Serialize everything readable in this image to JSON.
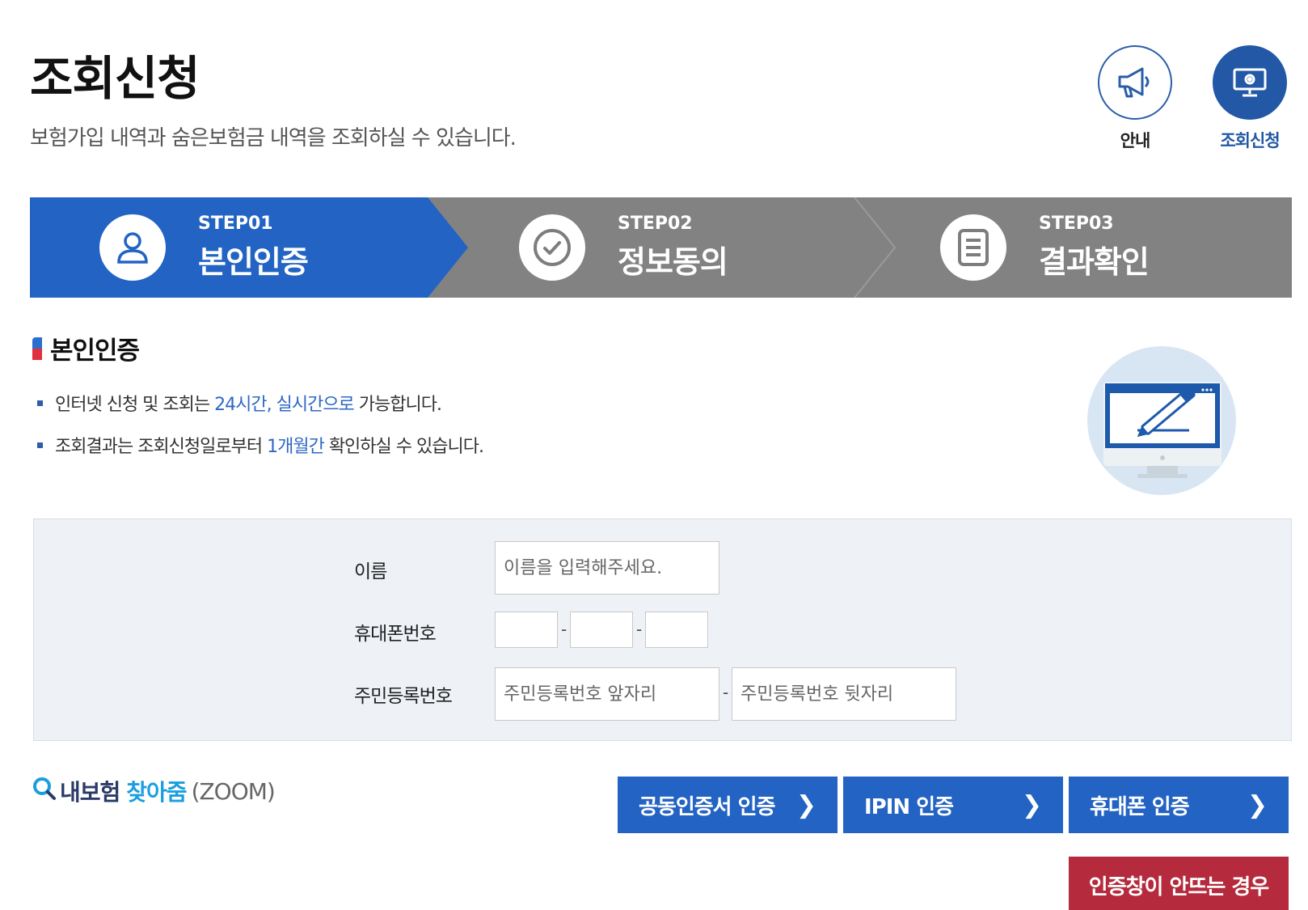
{
  "header": {
    "title": "조회신청",
    "subtitle": "보험가입 내역과 숨은보험금 내역을 조회하실 수 있습니다.",
    "guide_button": {
      "label": "안내",
      "icon": "megaphone-icon"
    },
    "apply_button": {
      "label": "조회신청",
      "icon": "monitor-icon"
    }
  },
  "steps": [
    {
      "num": "STEP01",
      "name": "본인인증",
      "icon": "user-icon",
      "active": true
    },
    {
      "num": "STEP02",
      "name": "정보동의",
      "icon": "check-circle-icon",
      "active": false
    },
    {
      "num": "STEP03",
      "name": "결과확인",
      "icon": "document-icon",
      "active": false
    }
  ],
  "section": {
    "title": "본인인증",
    "notes": [
      {
        "pre": "인터넷 신청 및 조회는 ",
        "hl": "24시간, 실시간으로",
        "post": " 가능합니다."
      },
      {
        "pre": "조회결과는 조회신청일로부터 ",
        "hl": "1개월간",
        "post": " 확인하실 수 있습니다."
      }
    ]
  },
  "form": {
    "name_label": "이름",
    "name_placeholder": "이름을 입력해주세요.",
    "phone_label": "휴대폰번호",
    "phone_sep": "-",
    "rrn_label": "주민등록번호",
    "rrn_front_placeholder": "주민등록번호 앞자리",
    "rrn_back_placeholder": "주민등록번호 뒷자리",
    "rrn_sep": "-"
  },
  "zoom": {
    "part1": "내보험",
    "part2": "찾아줌",
    "part3": "(ZOOM)"
  },
  "auth_buttons": {
    "cert": "공동인증서 인증",
    "ipin": "IPIN 인증",
    "phone": "휴대폰 인증",
    "arrow": "❯"
  },
  "fail_button": "인증창이 안뜨는 경우",
  "colors": {
    "primary": "#2263c3",
    "step_inactive": "#828282",
    "danger": "#b52a3c",
    "highlight": "#2d68c4"
  }
}
